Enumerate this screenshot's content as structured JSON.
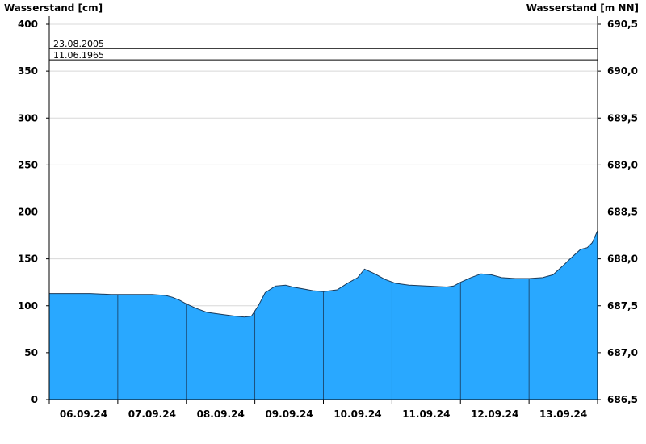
{
  "chart_data": {
    "type": "area",
    "ylabel_left": "Wasserstand [cm]",
    "ylabel_right": "Wasserstand [m NN]",
    "ylim": [
      0,
      400
    ],
    "y_ticks": [
      0,
      50,
      100,
      150,
      200,
      250,
      300,
      350,
      400
    ],
    "y2_ticks": [
      "686,5",
      "687,0",
      "687,5",
      "688,0",
      "688,5",
      "689,0",
      "689,5",
      "690,0",
      "690,5"
    ],
    "x_categories": [
      "06.09.24",
      "07.09.24",
      "08.09.24",
      "09.09.24",
      "10.09.24",
      "11.09.24",
      "12.09.24",
      "13.09.24"
    ],
    "grid": true,
    "fill_color": "#29A8FF",
    "reference_lines": [
      {
        "label": "23.08.2005",
        "value": 374
      },
      {
        "label": "11.06.1965",
        "value": 362
      }
    ],
    "x_days": [
      0,
      0.3,
      0.6,
      0.9,
      1.0,
      1.3,
      1.5,
      1.7,
      1.8,
      1.9,
      2.0,
      2.15,
      2.3,
      2.5,
      2.7,
      2.85,
      2.95,
      3.05,
      3.15,
      3.3,
      3.45,
      3.55,
      3.7,
      3.85,
      4.0,
      4.2,
      4.35,
      4.5,
      4.6,
      4.75,
      4.9,
      5.05,
      5.25,
      5.5,
      5.8,
      5.9,
      6.0,
      6.15,
      6.3,
      6.45,
      6.6,
      6.8,
      7.0,
      7.2,
      7.35,
      7.5,
      7.6,
      7.75,
      7.85,
      7.92,
      8.0
    ],
    "values": [
      113,
      113,
      113,
      112,
      112,
      112,
      112,
      111,
      109,
      106,
      102,
      97,
      93,
      91,
      89,
      88,
      89,
      100,
      114,
      121,
      122,
      120,
      118,
      116,
      115,
      117,
      124,
      130,
      139,
      134,
      128,
      124,
      122,
      121,
      120,
      121,
      125,
      130,
      134,
      133,
      130,
      129,
      129,
      130,
      133,
      143,
      150,
      160,
      162,
      167,
      180
    ]
  }
}
